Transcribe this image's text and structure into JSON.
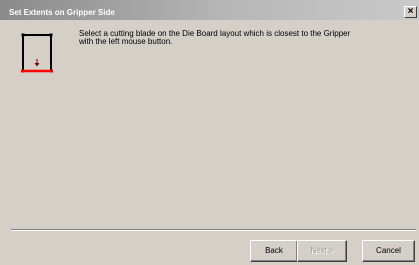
{
  "window": {
    "title": "Set Extents on Gripper Side",
    "close_label": "×"
  },
  "instruction": {
    "line1": "Select a cutting blade on the Die Board layout which is closest to the Gripper",
    "line2": "with the left mouse button."
  },
  "icon": {
    "name": "gripper-side-icon",
    "frame_color": "#000000",
    "highlight_color": "#ff0000",
    "arrow_color": "#800000"
  },
  "buttons": {
    "back": "Back",
    "next": "Next >",
    "cancel": "Cancel"
  }
}
